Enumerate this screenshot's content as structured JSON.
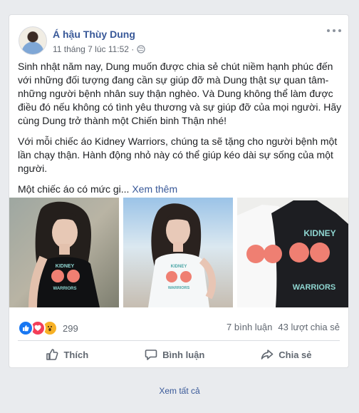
{
  "post": {
    "author": "Á hậu Thùy Dung",
    "timestamp": "11 tháng 7 lúc 11:52 ·",
    "paragraphs": [
      "Sinh nhật năm nay, Dung muốn được chia sẻ chút niềm hạnh phúc đến với những đối tượng đang cần sự giúp đỡ mà Dung thật sự quan tâm- những người bệnh nhân suy thận nghèo. Và Dung không thể làm được điều đó nếu không có tình yêu thương và sự giúp đỡ của mọi người. Hãy cùng Dung trở thành một Chiến binh Thận nhé!",
      "Với mỗi chiếc áo Kidney Warriors, chúng ta sẽ tặng cho người bệnh một lần chạy thận. Hành động nhỏ này có thể giúp kéo dài sự sống của một người."
    ],
    "truncated_text": "Một chiếc áo có mức gi...",
    "see_more": "Xem thêm",
    "shirt_text": {
      "top": "KIDNEY",
      "bottom": "WARRIORS"
    },
    "reactions": {
      "icons": [
        "like-icon",
        "love-icon",
        "wow-icon"
      ],
      "count": "299"
    },
    "comments": "7 bình luận",
    "shares": "43 lượt chia sẻ",
    "actions": {
      "like": "Thích",
      "comment": "Bình luận",
      "share": "Chia sẻ"
    }
  },
  "footer": {
    "see_all": "Xem tất cả"
  },
  "colors": {
    "link": "#385898",
    "background": "#e9ebee",
    "card": "#ffffff",
    "muted": "#606770"
  }
}
